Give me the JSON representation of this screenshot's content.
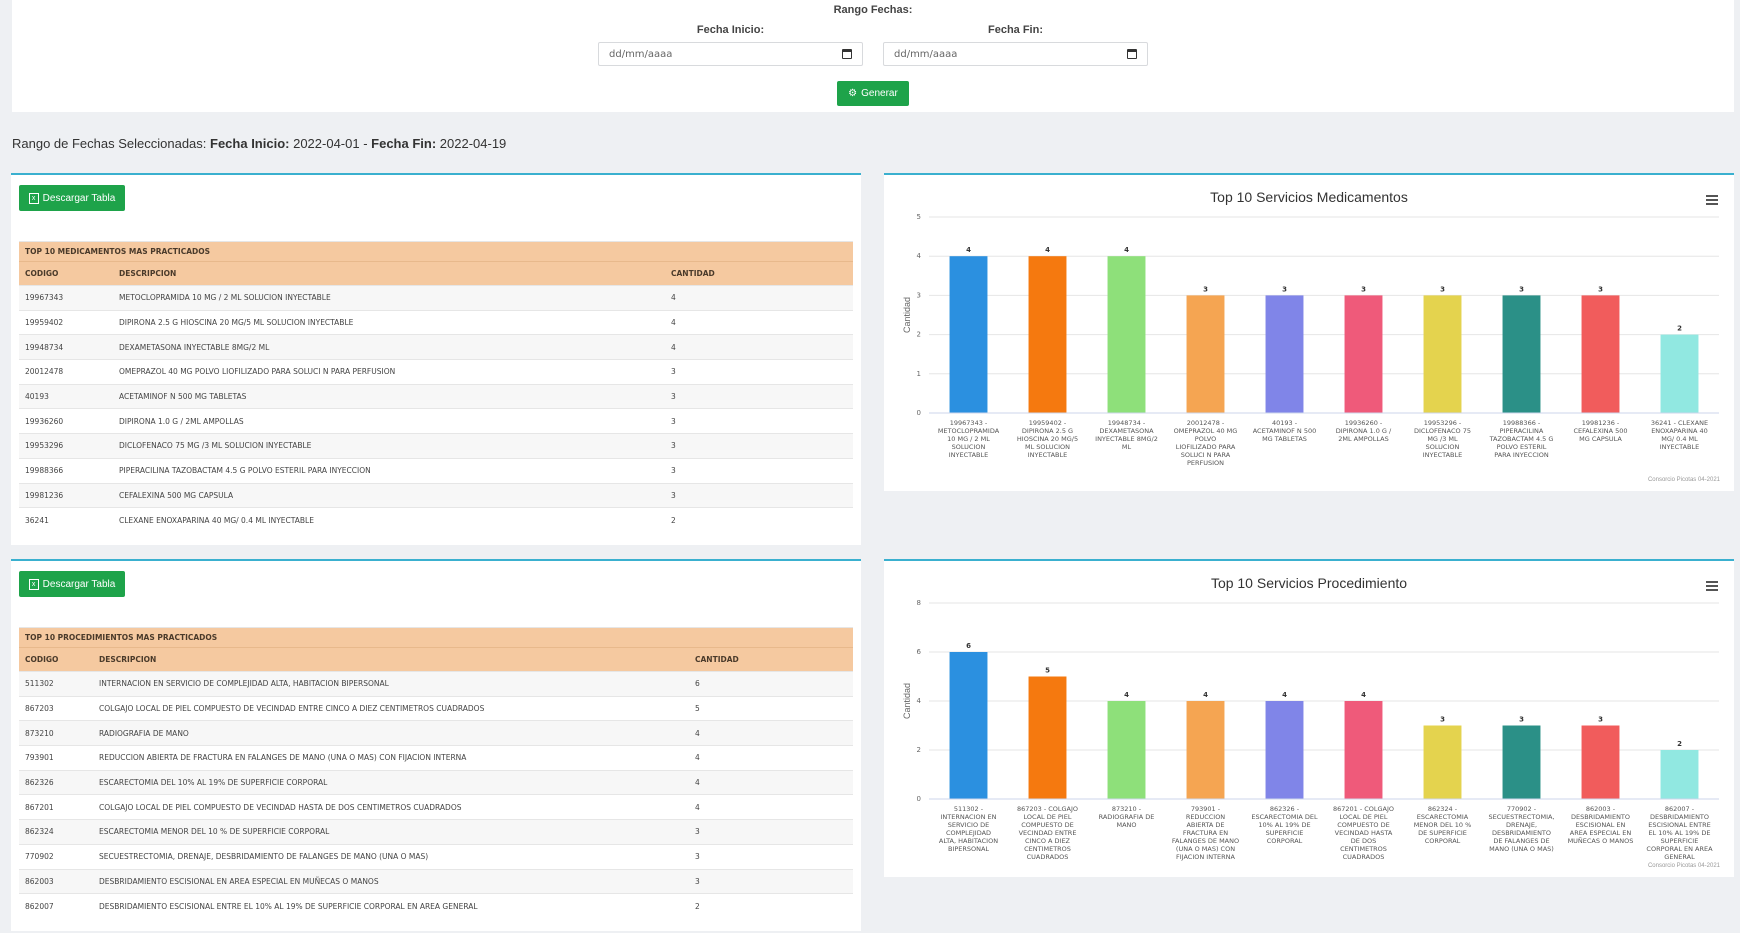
{
  "filters": {
    "range_title": "Rango Fechas:",
    "start_label": "Fecha Inicio:",
    "end_label": "Fecha Fin:",
    "start_placeholder": "dd/mm/aaaa",
    "end_placeholder": "dd/mm/aaaa",
    "generate_label": "Generar"
  },
  "selected": {
    "prefix": "Rango de Fechas Seleccionadas: ",
    "start_label": "Fecha Inicio:",
    "start_value": " 2022-04-01 - ",
    "end_label": "Fecha Fin:",
    "end_value": " 2022-04-19"
  },
  "download_label": "Descargar Tabla",
  "table1": {
    "caption": "TOP 10 MEDICAMENTOS MAS PRACTICADOS",
    "headers": [
      "CODIGO",
      "DESCRIPCION",
      "CANTIDAD"
    ],
    "rows": [
      [
        "19967343",
        "METOCLOPRAMIDA 10 MG / 2 ML SOLUCION INYECTABLE",
        "4"
      ],
      [
        "19959402",
        "DIPIRONA 2.5 G HIOSCINA 20 MG/5 ML SOLUCION INYECTABLE",
        "4"
      ],
      [
        "19948734",
        "DEXAMETASONA INYECTABLE 8MG/2 ML",
        "4"
      ],
      [
        "20012478",
        "OMEPRAZOL 40 MG POLVO LIOFILIZADO PARA SOLUCI N PARA PERFUSION",
        "3"
      ],
      [
        "40193",
        "ACETAMINOF N 500 MG TABLETAS",
        "3"
      ],
      [
        "19936260",
        "DIPIRONA 1.0 G / 2ML AMPOLLAS",
        "3"
      ],
      [
        "19953296",
        "DICLOFENACO 75 MG /3 ML SOLUCION INYECTABLE",
        "3"
      ],
      [
        "19988366",
        "PIPERACILINA TAZOBACTAM 4.5 G POLVO ESTERIL PARA INYECCION",
        "3"
      ],
      [
        "19981236",
        "CEFALEXINA 500 MG CAPSULA",
        "3"
      ],
      [
        "36241",
        "CLEXANE ENOXAPARINA 40 MG/ 0.4 ML INYECTABLE",
        "2"
      ]
    ]
  },
  "table2": {
    "caption": "TOP 10 PROCEDIMIENTOS MAS PRACTICADOS",
    "headers": [
      "CODIGO",
      "DESCRIPCION",
      "CANTIDAD"
    ],
    "rows": [
      [
        "511302",
        "INTERNACION EN SERVICIO DE COMPLEJIDAD ALTA, HABITACION BIPERSONAL",
        "6"
      ],
      [
        "867203",
        "COLGAJO LOCAL DE PIEL COMPUESTO DE VECINDAD ENTRE CINCO A DIEZ CENTIMETROS CUADRADOS",
        "5"
      ],
      [
        "873210",
        "RADIOGRAFIA DE MANO",
        "4"
      ],
      [
        "793901",
        "REDUCCION ABIERTA DE FRACTURA EN FALANGES DE MANO (UNA O MAS) CON FIJACION INTERNA",
        "4"
      ],
      [
        "862326",
        "ESCARECTOMIA DEL 10% AL 19% DE SUPERFICIE CORPORAL",
        "4"
      ],
      [
        "867201",
        "COLGAJO LOCAL DE PIEL COMPUESTO DE VECINDAD HASTA DE DOS CENTIMETROS CUADRADOS",
        "4"
      ],
      [
        "862324",
        "ESCARECTOMIA MENOR DEL 10 % DE SUPERFICIE CORPORAL",
        "3"
      ],
      [
        "770902",
        "SECUESTRECTOMIA, DRENAJE, DESBRIDAMIENTO DE FALANGES DE MANO (UNA O MAS)",
        "3"
      ],
      [
        "862003",
        "DESBRIDAMIENTO ESCISIONAL EN AREA ESPECIAL EN MUÑECAS O MANOS",
        "3"
      ],
      [
        "862007",
        "DESBRIDAMIENTO ESCISIONAL ENTRE EL 10% AL 19% DE SUPERFICIE CORPORAL EN AREA GENERAL",
        "2"
      ]
    ]
  },
  "chart_data": [
    {
      "type": "bar",
      "title": "Top 10 Servicios Medicamentos",
      "ylabel": "Cantidad",
      "ylim": [
        0,
        5
      ],
      "yticks": [
        0,
        1,
        2,
        3,
        4,
        5
      ],
      "credits": "Consorcio Picotas 04-2021",
      "categories": [
        "19967343 - METOCLOPRAMIDA 10 MG / 2 ML SOLUCION INYECTABLE",
        "19959402 - DIPIRONA 2.5 G HIOSCINA 20 MG/5 ML SOLUCION INYECTABLE",
        "19948734 - DEXAMETASONA INYECTABLE 8MG/2 ML",
        "20012478 - OMEPRAZOL 40 MG POLVO LIOFILIZADO PARA SOLUCI N PARA PERFUSION",
        "40193 - ACETAMINOF N 500 MG TABLETAS",
        "19936260 - DIPIRONA 1.0 G / 2ML AMPOLLAS",
        "19953296 - DICLOFENACO 75 MG /3 ML SOLUCION INYECTABLE",
        "19988366 - PIPERACILINA TAZOBACTAM 4.5 G POLVO ESTERIL PARA INYECCION",
        "19981236 - CEFALEXINA 500 MG CAPSULA",
        "36241 - CLEXANE ENOXAPARINA 40 MG/ 0.4 ML INYECTABLE"
      ],
      "values": [
        4,
        4,
        4,
        3,
        3,
        3,
        3,
        3,
        3,
        2
      ],
      "colors": [
        "#2b90e0",
        "#f5790f",
        "#8ee07a",
        "#f5a552",
        "#8085e8",
        "#ef5a7a",
        "#e4d34e",
        "#2b9087",
        "#f15c5c",
        "#91e8e1"
      ]
    },
    {
      "type": "bar",
      "title": "Top 10 Servicios Procedimiento",
      "ylabel": "Cantidad",
      "ylim": [
        0,
        8
      ],
      "yticks": [
        0,
        2,
        4,
        6,
        8
      ],
      "credits": "Consorcio Picotas 04-2021",
      "categories": [
        "511302 - INTERNACION EN SERVICIO DE COMPLEJIDAD ALTA, HABITACION BIPERSONAL",
        "867203 - COLGAJO LOCAL DE PIEL COMPUESTO DE VECINDAD ENTRE CINCO A DIEZ CENTIMETROS CUADRADOS",
        "873210 - RADIOGRAFIA DE MANO",
        "793901 - REDUCCION ABIERTA DE FRACTURA EN FALANGES DE MANO (UNA O MAS) CON FIJACION INTERNA",
        "862326 - ESCARECTOMIA DEL 10% AL 19% DE SUPERFICIE CORPORAL",
        "867201 - COLGAJO LOCAL DE PIEL COMPUESTO DE VECINDAD HASTA DE DOS CENTIMETROS CUADRADOS",
        "862324 - ESCARECTOMIA MENOR DEL 10 % DE SUPERFICIE CORPORAL",
        "770902 - SECUESTRECTOMIA, DRENAJE, DESBRIDAMIENTO DE FALANGES DE MANO (UNA O MAS)",
        "862003 - DESBRIDAMIENTO ESCISIONAL EN AREA ESPECIAL EN MUÑECAS O MANOS",
        "862007 - DESBRIDAMIENTO ESCISIONAL ENTRE EL 10% AL 19% DE SUPERFICIE CORPORAL EN AREA GENERAL"
      ],
      "values": [
        6,
        5,
        4,
        4,
        4,
        4,
        3,
        3,
        3,
        2
      ],
      "colors": [
        "#2b90e0",
        "#f5790f",
        "#8ee07a",
        "#f5a552",
        "#8085e8",
        "#ef5a7a",
        "#e4d34e",
        "#2b9087",
        "#f15c5c",
        "#91e8e1"
      ]
    }
  ]
}
